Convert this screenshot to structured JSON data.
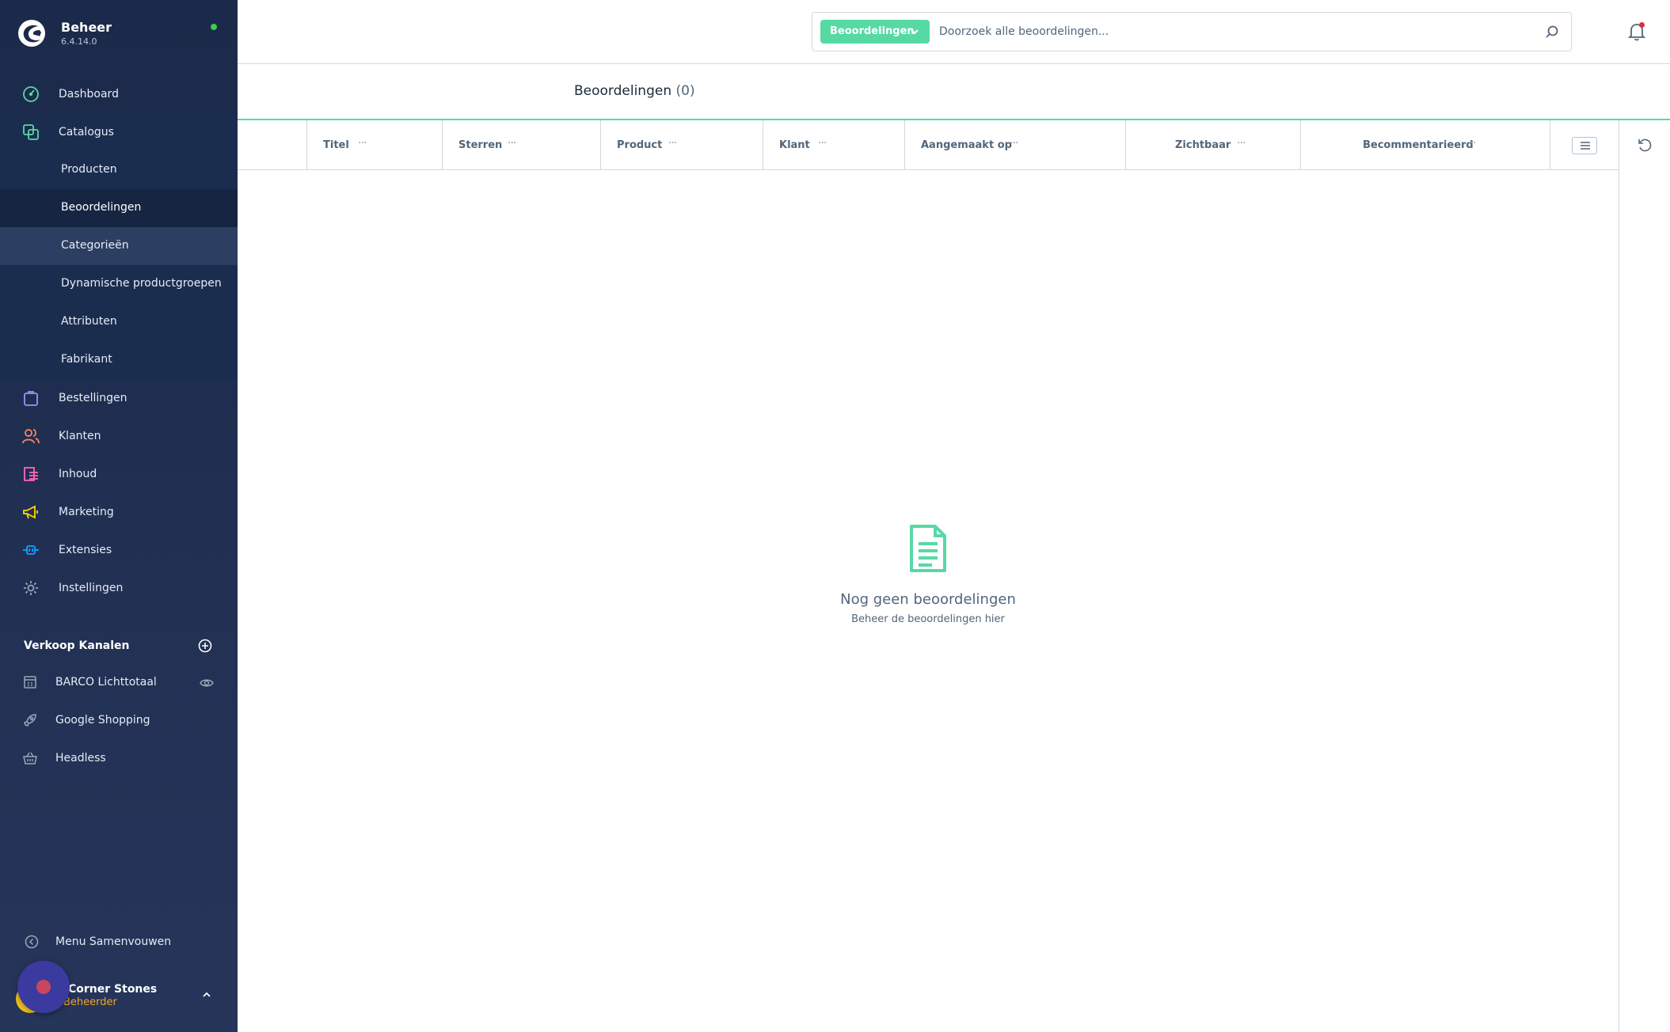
{
  "app": {
    "name": "Beheer",
    "version": "6.4.14.0"
  },
  "sidebar": {
    "items": [
      {
        "label": "Dashboard",
        "icon": "dashboard-icon",
        "color": "#57d9a3"
      },
      {
        "label": "Catalogus",
        "icon": "catalog-icon",
        "color": "#57d9a3"
      },
      {
        "label": "Bestellingen",
        "icon": "bag-icon",
        "color": "#a092f0"
      },
      {
        "label": "Klanten",
        "icon": "users-icon",
        "color": "#f88962"
      },
      {
        "label": "Inhoud",
        "icon": "content-icon",
        "color": "#ff68b4"
      },
      {
        "label": "Marketing",
        "icon": "megaphone-icon",
        "color": "#ffd700"
      },
      {
        "label": "Extensies",
        "icon": "plug-icon",
        "color": "#189eff"
      },
      {
        "label": "Instellingen",
        "icon": "gear-icon",
        "color": "#9aa8b5"
      }
    ],
    "catalog_sub": [
      {
        "label": "Producten"
      },
      {
        "label": "Beoordelingen"
      },
      {
        "label": "Categorieën"
      },
      {
        "label": "Dynamische productgroepen"
      },
      {
        "label": "Attributen"
      },
      {
        "label": "Fabrikant"
      }
    ],
    "channels_title": "Verkoop Kanalen",
    "channels": [
      {
        "label": "BARCO Lichttotaal",
        "icon": "storefront-icon"
      },
      {
        "label": "Google Shopping",
        "icon": "rocket-icon"
      },
      {
        "label": "Headless",
        "icon": "basket-icon"
      }
    ],
    "collapse_label": "Menu Samenvouwen",
    "user": {
      "name": "Corner Stones",
      "role": "Beheerder"
    }
  },
  "search": {
    "type_label": "Beoordelingen",
    "placeholder": "Doorzoek alle beoordelingen..."
  },
  "page": {
    "title": "Beoordelingen",
    "count": "(0)"
  },
  "grid": {
    "columns": [
      {
        "label": "Titel"
      },
      {
        "label": "Sterren"
      },
      {
        "label": "Product"
      },
      {
        "label": "Klant"
      },
      {
        "label": "Aangemaakt op"
      },
      {
        "label": "Zichtbaar"
      },
      {
        "label": "Becommentarieerd"
      }
    ]
  },
  "empty_state": {
    "title": "Nog geen beoordelingen",
    "subtitle": "Beheer de beoordelingen hier"
  },
  "colors": {
    "accent": "#57d9a3",
    "sidebar_bg": "#1b2a4a",
    "role": "#f5a524"
  }
}
